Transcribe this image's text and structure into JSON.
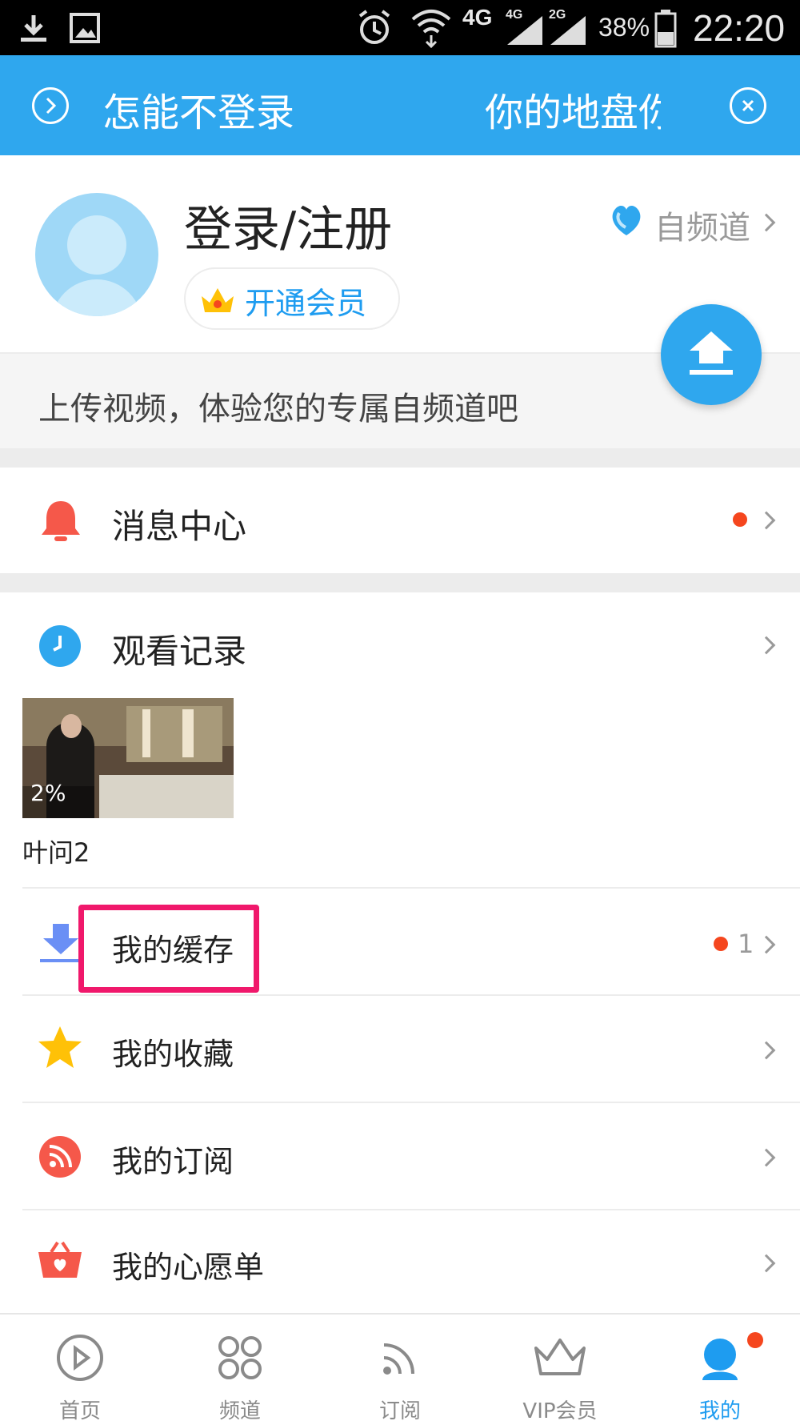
{
  "status_bar": {
    "network_4g": "4G",
    "sim1": "4G",
    "sim2": "2G",
    "battery": "38%",
    "time": "22:20",
    "icons": [
      "download-icon",
      "image-icon",
      "alarm-icon",
      "wifi-icon",
      "signal-icon",
      "battery-icon"
    ]
  },
  "banner": {
    "text_left": "怎能不登录",
    "text_right": "你的地盘你",
    "icons": [
      "play-circle-icon",
      "close-circle-icon"
    ]
  },
  "profile": {
    "login_text": "登录/注册",
    "vip_text": "开通会员",
    "channel_text": "自频道",
    "upload_hint": "上传视频，体验您的专属自频道吧"
  },
  "menu": {
    "messages": "消息中心",
    "history": "观看记录",
    "history_item": {
      "title": "叶问2",
      "progress": "2%"
    },
    "downloads": "我的缓存",
    "downloads_count": "1",
    "favorites": "我的收藏",
    "subscriptions": "我的订阅",
    "wishlist": "我的心愿单"
  },
  "tabs": [
    {
      "label": "首页",
      "icon": "play-circle-icon"
    },
    {
      "label": "频道",
      "icon": "grid-icon"
    },
    {
      "label": "订阅",
      "icon": "rss-icon"
    },
    {
      "label": "VIP会员",
      "icon": "crown-icon"
    },
    {
      "label": "我的",
      "icon": "profile-icon"
    }
  ],
  "colors": {
    "brand_blue": "#2fa7ee",
    "active_tab": "#1e9cf0",
    "badge_red": "#f5461e",
    "highlight_pink": "#f0186b",
    "star_yellow": "#ffc107",
    "bell_red": "#f5584a"
  }
}
